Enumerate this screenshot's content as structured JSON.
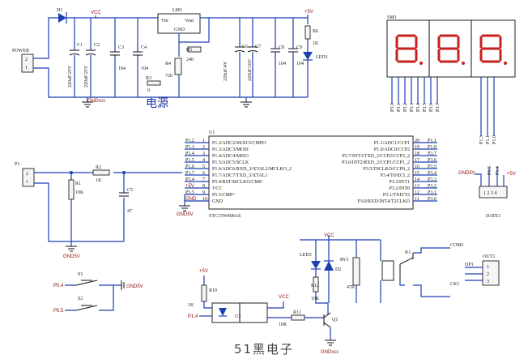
{
  "power_section": {
    "connector_ref": "POWER",
    "diode_ref": "D1",
    "regulator_ref": "LM1",
    "regulator_pins": [
      "Vin",
      "Vout",
      "GND"
    ],
    "vcc_label": "VCC",
    "v5_label": "+5V",
    "gnd_label": "GNDvcc",
    "title": "电源",
    "caps": [
      {
        "ref": "C1",
        "value": "220uF/25V"
      },
      {
        "ref": "C2",
        "value": "220uF/25V"
      },
      {
        "ref": "C3",
        "value": "104"
      },
      {
        "ref": "C4",
        "value": "104"
      },
      {
        "ref": "C6",
        "value": "220uF/4V"
      },
      {
        "ref": "C7",
        "value": "220uF/16V"
      },
      {
        "ref": "C8",
        "value": "104"
      },
      {
        "ref": "C9",
        "value": "104"
      }
    ],
    "resistors": [
      {
        "ref": "R3",
        "value": "0"
      },
      {
        "ref": "R4",
        "value": "720"
      },
      {
        "ref": "R5",
        "value": "240"
      },
      {
        "ref": "R6",
        "value": "1K"
      }
    ],
    "led_ref": "LED1"
  },
  "display": {
    "ref": "SM1",
    "digits": [
      "8",
      "8",
      "8"
    ],
    "pin_labels": [
      "P3.0",
      "P3.1",
      "P3.2",
      "P3.3",
      "P3.4",
      "P3.5",
      "P3.6",
      "P3.7"
    ],
    "com_pins": [
      "P1.3",
      "P1.1",
      "P1.0"
    ]
  },
  "mcu": {
    "ref": "U1",
    "part": "STC15W408AS",
    "left_pins": [
      {
        "num": "1",
        "net": "P1.2",
        "name": "P1.2/ADC2/SS/ECI/CMPO"
      },
      {
        "num": "2",
        "net": "P1.3",
        "name": "P1.3/ADC3/MOSI"
      },
      {
        "num": "3",
        "net": "P1.4",
        "name": "P1.4/ADC4/MISO"
      },
      {
        "num": "4",
        "net": "P1.5",
        "name": "P1.5/ADC5/SCLK"
      },
      {
        "num": "5",
        "net": "P1.6",
        "name": "P1.6/ADC6/RXD_3/XTAL2/MCLKO_2"
      },
      {
        "num": "6",
        "net": "P1.7",
        "name": "P1.7/ADC7/TXD_3/XTAL1"
      },
      {
        "num": "7",
        "net": "P5.4",
        "name": "P5.4/RST/MCLKO/CMP-"
      },
      {
        "num": "8",
        "net": "+5V",
        "name": "VCC"
      },
      {
        "num": "9",
        "net": "P5.5",
        "name": "P5.5/CMP+"
      },
      {
        "num": "10",
        "net": "GND",
        "name": "GND"
      }
    ],
    "right_pins": [
      {
        "num": "20",
        "net": "P1.1",
        "name": "P1.1/ADC1/CCP1"
      },
      {
        "num": "19",
        "net": "P1.0",
        "name": "P1.0/ADC0/CCP2"
      },
      {
        "num": "18",
        "net": "P3.7",
        "name": "P3.7/INT3/TXD_2/CCP2/CCP2_2"
      },
      {
        "num": "17",
        "net": "P3.6",
        "name": "P3.6/INT2/RXD_2/CCP1/CCP1_2"
      },
      {
        "num": "16",
        "net": "P3.5",
        "name": "P3.5/T0CLKO/CCP0_2"
      },
      {
        "num": "15",
        "net": "P3.4",
        "name": "P3.4/T0/ECI_2"
      },
      {
        "num": "14",
        "net": "P3.3",
        "name": "P3.3/INT1"
      },
      {
        "num": "13",
        "net": "P3.2",
        "name": "P3.2/INT0"
      },
      {
        "num": "12",
        "net": "P3.1",
        "name": "P3.1/TXD/T2"
      },
      {
        "num": "11",
        "net": "P3.0",
        "name": "P3.0/RXD/INT4/T2CLKO"
      }
    ],
    "gnd_label": "GND5V"
  },
  "input_section": {
    "connector_ref": "P1",
    "r1": {
      "ref": "R1",
      "value": "10K"
    },
    "r2": {
      "ref": "R2",
      "value": "1K"
    },
    "c5": {
      "ref": "C5",
      "value": "47"
    },
    "gnd_label": "GND5V"
  },
  "date_connector": {
    "ref": "DATE1",
    "pins": [
      "P1.5",
      "P1.4"
    ],
    "gnd": "GND5V",
    "v5": "+5V"
  },
  "switches": {
    "s1": {
      "ref": "S1",
      "net": "P5.4"
    },
    "s2": {
      "ref": "S2",
      "net": "P5.5"
    },
    "gnd_label": "GND5V"
  },
  "output_section": {
    "led_ref": "LED3",
    "diode_ref": "D2",
    "rv_ref": "RV1",
    "rv_value": "47K",
    "r12": {
      "ref": "R12",
      "value": "10K"
    },
    "r10": {
      "ref": "R10",
      "value": "1K"
    },
    "r11": {
      "ref": "R11",
      "value": "10K"
    },
    "q_ref": "Q1",
    "u_ref": "U2",
    "relay_ref": "K1",
    "out_ref": "OUT1",
    "out_pins": [
      "COM1",
      "OP1",
      "CK1"
    ],
    "v5_label": "+5V",
    "vcc_label": "VCC",
    "gnd_label": "GNDvcc",
    "p14": "P1.4"
  },
  "footer": "51黑电子"
}
